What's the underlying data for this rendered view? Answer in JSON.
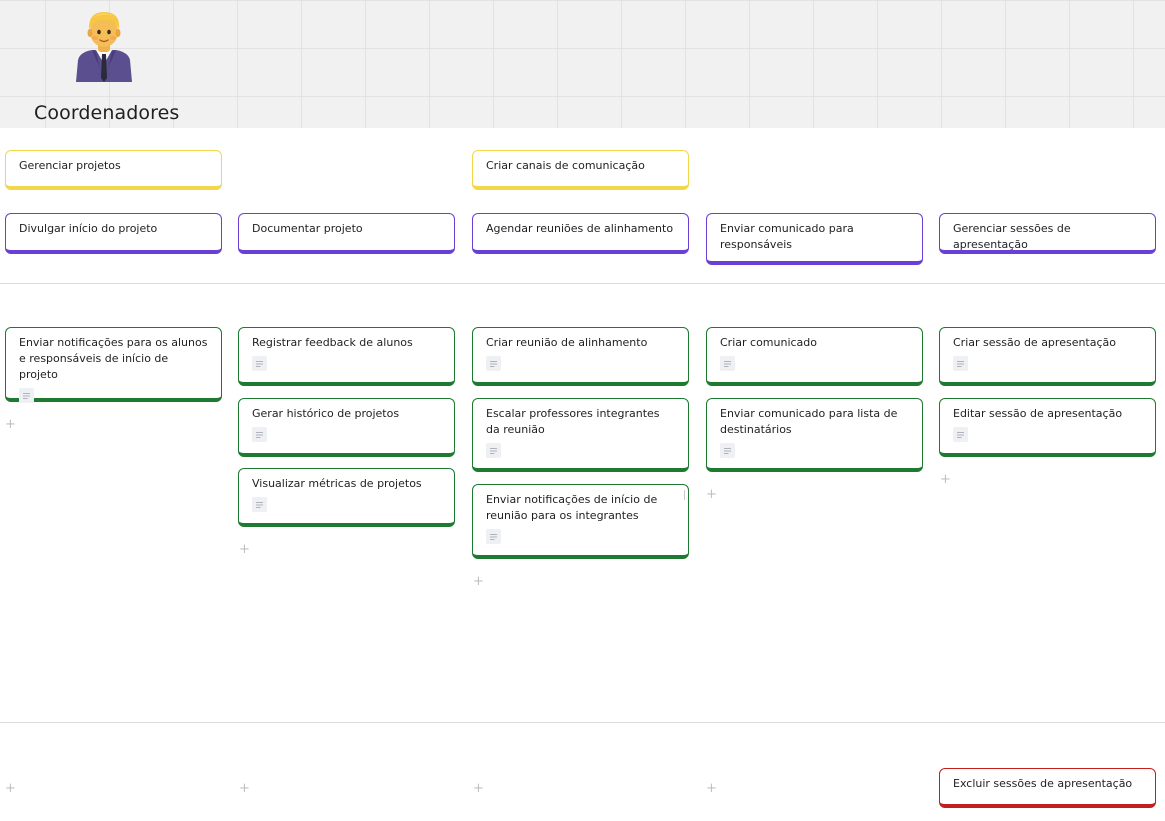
{
  "board": {
    "title": "Coordenadores",
    "avatar_icon": "office-worker-emoji-icon"
  },
  "colors": {
    "epic": "#f2d74a",
    "feature": "#6a3fd6",
    "story": "#1d7a30",
    "release_story": "#c41f1f"
  },
  "epics": {
    "gerenciar_projetos": "Gerenciar projetos",
    "criar_canais": "Criar canais de comunicação"
  },
  "features": {
    "divulgar_inicio": "Divulgar início do projeto",
    "documentar_projeto": "Documentar projeto",
    "agendar_reunioes": "Agendar reuniões de alinhamento",
    "enviar_comunicado": "Enviar comunicado para responsáveis",
    "gerenciar_sessoes": "Gerenciar sessões de apresentação"
  },
  "stories": {
    "col1": [
      "Enviar notificações para os alunos e responsáveis de início de projeto"
    ],
    "col2": [
      "Registrar feedback de alunos",
      "Gerar histórico de projetos",
      "Visualizar métricas de projetos"
    ],
    "col3": [
      "Criar reunião de alinhamento",
      "Escalar professores integrantes da reunião",
      "Enviar notificações de início de reunião para os integrantes"
    ],
    "col4": [
      "Criar comunicado",
      "Enviar comunicado para lista de destinatários"
    ],
    "col5": [
      "Criar sessão de apresentação",
      "Editar sessão de apresentação"
    ]
  },
  "release2": {
    "col5": [
      "Excluir sessões de apresentação"
    ]
  },
  "add_symbol": "+"
}
